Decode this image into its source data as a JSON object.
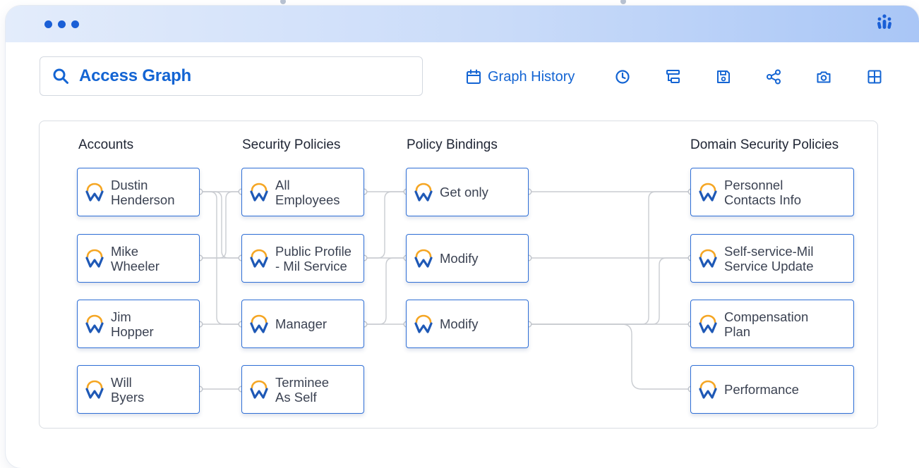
{
  "window": {
    "brand_icon": "workday-people-icon",
    "accent_color": "#1364d3"
  },
  "search": {
    "icon": "search-icon",
    "title": "Access Graph"
  },
  "toolbar": {
    "graph_history_label": "Graph History",
    "graph_history_icon": "calendar-icon",
    "icons": [
      "clock-icon",
      "hierarchy-icon",
      "save-icon",
      "share-icon",
      "camera-icon",
      "grid-icon"
    ]
  },
  "graph": {
    "columns": {
      "accounts": "Accounts",
      "security_policies": "Security Policies",
      "policy_bindings": "Policy Bindings",
      "domain_security_policies": "Domain Security Policies"
    },
    "accounts": [
      "Dustin\nHenderson",
      "Mike\nWheeler",
      "Jim\nHopper",
      "Will\nByers"
    ],
    "security_policies": [
      "All\nEmployees",
      "Public Profile\n- Mil Service",
      "Manager",
      "Terminee\nAs Self"
    ],
    "policy_bindings": [
      "Get only",
      "Modify",
      "Modify"
    ],
    "domain_security_policies": [
      "Personnel\nContacts Info",
      "Self-service-Mil\nService Update",
      "Compensation\nPlan",
      "Performance"
    ]
  }
}
